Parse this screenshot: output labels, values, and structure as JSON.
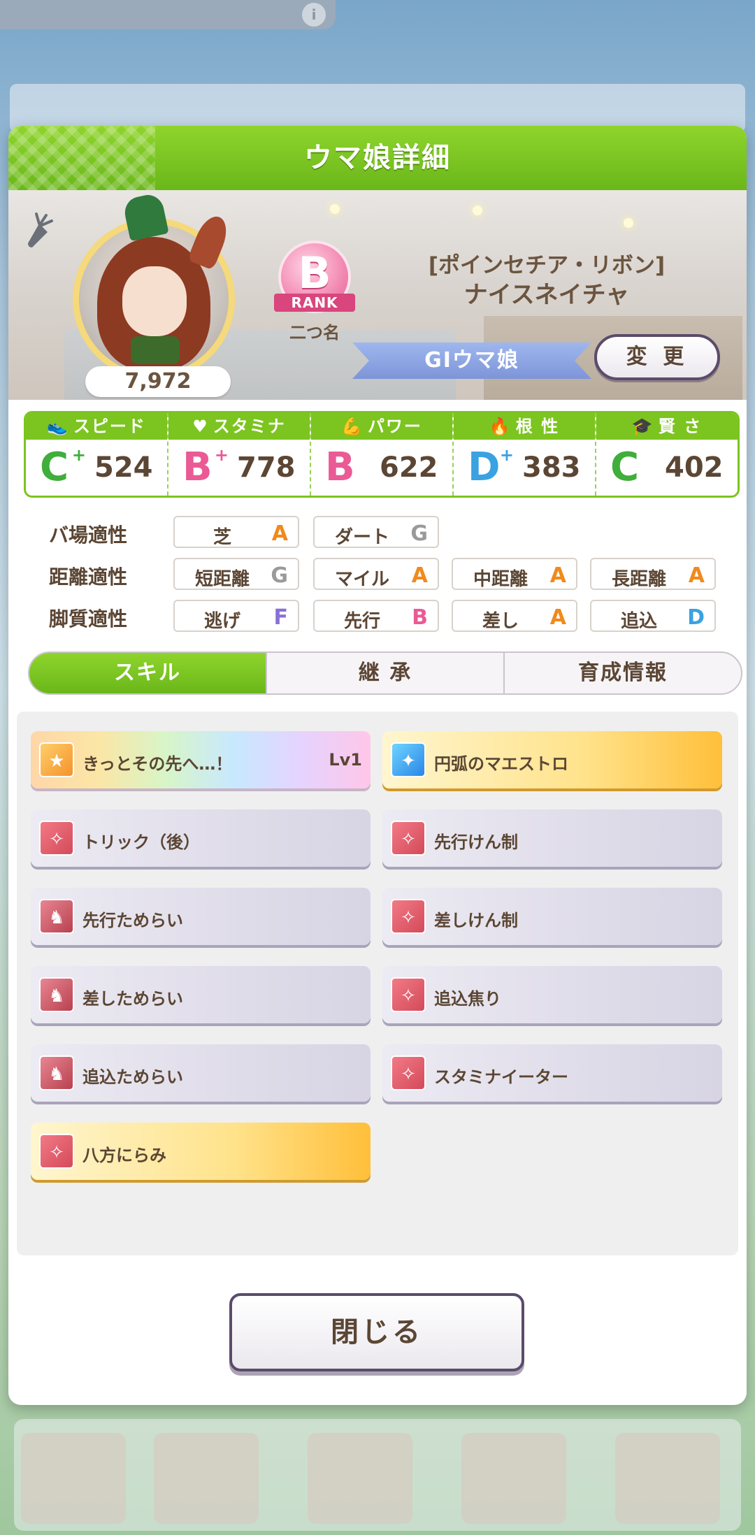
{
  "dialog": {
    "title": "ウマ娘詳細",
    "close_label": "閉じる"
  },
  "character": {
    "fans": "7,972",
    "rank": "B",
    "rank_label": "RANK",
    "nickname": "二つ名",
    "epithet": "[ポインセチア・リボン]",
    "name": "ナイスネイチャ",
    "title": "GⅠウマ娘",
    "change_label": "変 更"
  },
  "stats": [
    {
      "label": "スピード",
      "grade": "C",
      "plus": "+",
      "value": "524",
      "color": "#3fae3a",
      "icon": "shoe-icon"
    },
    {
      "label": "スタミナ",
      "grade": "B",
      "plus": "+",
      "value": "778",
      "color": "#ea5a95",
      "icon": "heart-icon"
    },
    {
      "label": "パワー",
      "grade": "B",
      "plus": "",
      "value": "622",
      "color": "#ea5a95",
      "icon": "arm-icon"
    },
    {
      "label": "根 性",
      "grade": "D",
      "plus": "+",
      "value": "383",
      "color": "#3aa2e0",
      "icon": "flame-icon"
    },
    {
      "label": "賢 さ",
      "grade": "C",
      "plus": "",
      "value": "402",
      "color": "#3fae3a",
      "icon": "mortarboard-icon"
    }
  ],
  "aptitude": {
    "track": {
      "label": "バ場適性",
      "items": [
        {
          "name": "芝",
          "grade": "A",
          "color": "#f08a1c"
        },
        {
          "name": "ダート",
          "grade": "G",
          "color": "#9a9a9a"
        }
      ]
    },
    "distance": {
      "label": "距離適性",
      "items": [
        {
          "name": "短距離",
          "grade": "G",
          "color": "#9a9a9a"
        },
        {
          "name": "マイル",
          "grade": "A",
          "color": "#f08a1c"
        },
        {
          "name": "中距離",
          "grade": "A",
          "color": "#f08a1c"
        },
        {
          "name": "長距離",
          "grade": "A",
          "color": "#f08a1c"
        }
      ]
    },
    "style": {
      "label": "脚質適性",
      "items": [
        {
          "name": "逃げ",
          "grade": "F",
          "color": "#8a6fd6"
        },
        {
          "name": "先行",
          "grade": "B",
          "color": "#ea5a95"
        },
        {
          "name": "差し",
          "grade": "A",
          "color": "#f08a1c"
        },
        {
          "name": "追込",
          "grade": "D",
          "color": "#3aa2e0"
        }
      ]
    }
  },
  "tabs": [
    {
      "label": "スキル",
      "active": true
    },
    {
      "label": "継 承",
      "active": false
    },
    {
      "label": "育成情報",
      "active": false
    }
  ],
  "skills": [
    {
      "name": "きっとその先へ…！",
      "level": "Lv1",
      "style": "rainbow",
      "icon": "orange"
    },
    {
      "name": "円弧のマエストロ",
      "level": "",
      "style": "gold",
      "icon": "blue"
    },
    {
      "name": "トリック（後）",
      "level": "",
      "style": "normal",
      "icon": "red"
    },
    {
      "name": "先行けん制",
      "level": "",
      "style": "normal",
      "icon": "red"
    },
    {
      "name": "先行ためらい",
      "level": "",
      "style": "normal",
      "icon": "dark"
    },
    {
      "name": "差しけん制",
      "level": "",
      "style": "normal",
      "icon": "red"
    },
    {
      "name": "差しためらい",
      "level": "",
      "style": "normal",
      "icon": "dark"
    },
    {
      "name": "追込焦り",
      "level": "",
      "style": "normal",
      "icon": "red"
    },
    {
      "name": "追込ためらい",
      "level": "",
      "style": "normal",
      "icon": "dark"
    },
    {
      "name": "スタミナイーター",
      "level": "",
      "style": "normal",
      "icon": "red"
    },
    {
      "name": "八方にらみ",
      "level": "",
      "style": "gold",
      "icon": "red"
    }
  ]
}
